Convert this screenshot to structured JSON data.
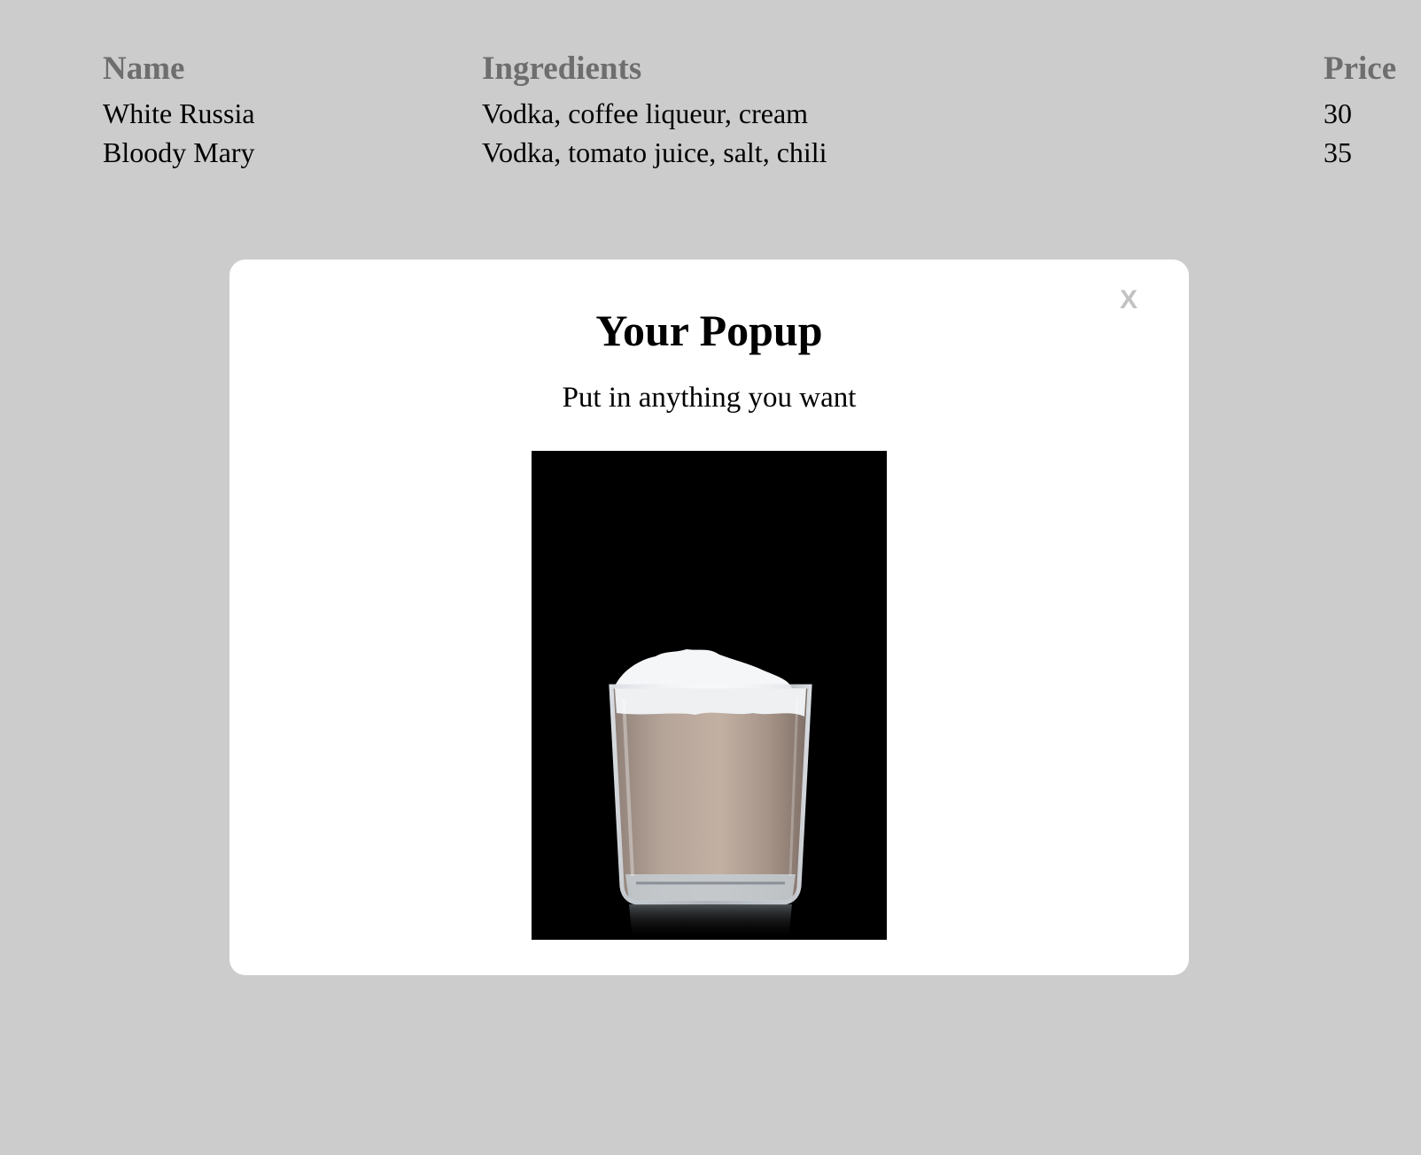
{
  "table": {
    "headers": {
      "name": "Name",
      "ingredients": "Ingredients",
      "price": "Price"
    },
    "rows": [
      {
        "name": "White Russia",
        "ingredients": "Vodka, coffee liqueur, cream",
        "price": "30"
      },
      {
        "name": "Bloody Mary",
        "ingredients": "Vodka, tomato juice, salt, chili",
        "price": "35"
      }
    ]
  },
  "popup": {
    "close_label": "X",
    "title": "Your Popup",
    "text": "Put in anything you want",
    "image": {
      "subject": "cocktail-glass-with-cream-foam",
      "background_color": "#000000"
    }
  },
  "colors": {
    "page_background": "#cccccc",
    "header_text": "#6e6e6e",
    "popup_background": "#ffffff",
    "close_button": "#c2c2c2"
  }
}
